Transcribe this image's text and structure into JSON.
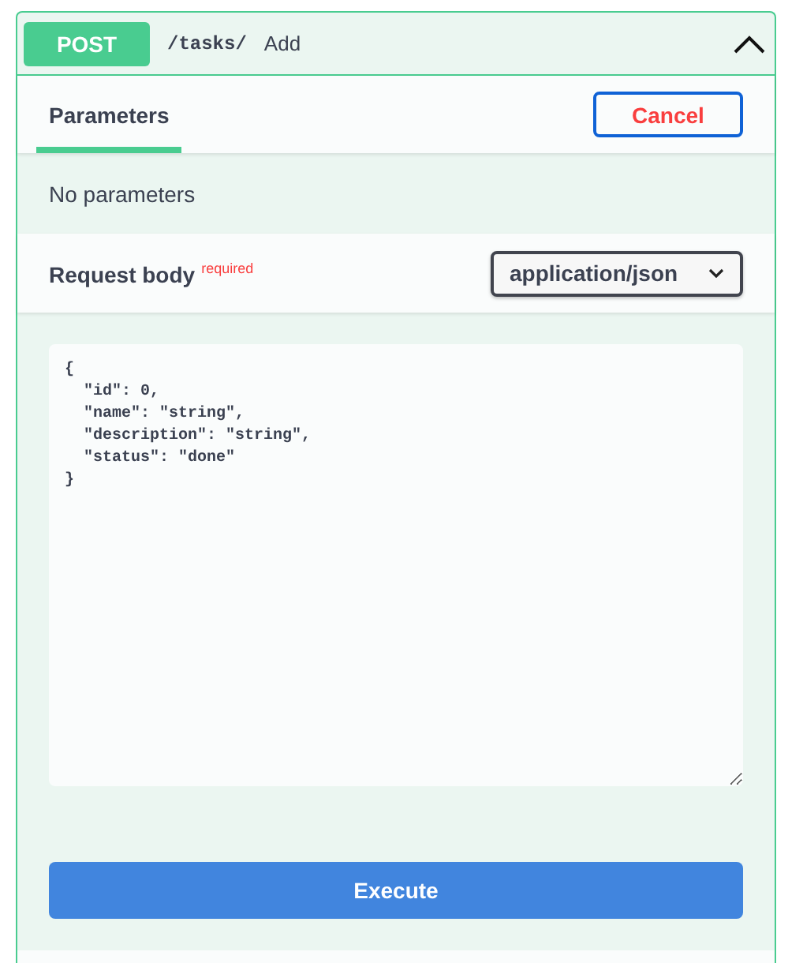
{
  "operation": {
    "method": "POST",
    "path": "/tasks/",
    "summary": "Add",
    "expanded": true
  },
  "tabs": [
    {
      "label": "Parameters",
      "selected": true
    }
  ],
  "cancel_button": "Cancel",
  "parameters_message": "No parameters",
  "request_body": {
    "title": "Request body",
    "required_label": "required",
    "content_type": "application/json",
    "value": "{\n  \"id\": 0,\n  \"name\": \"string\",\n  \"description\": \"string\",\n  \"status\": \"done\"\n}"
  },
  "execute_button": "Execute"
}
